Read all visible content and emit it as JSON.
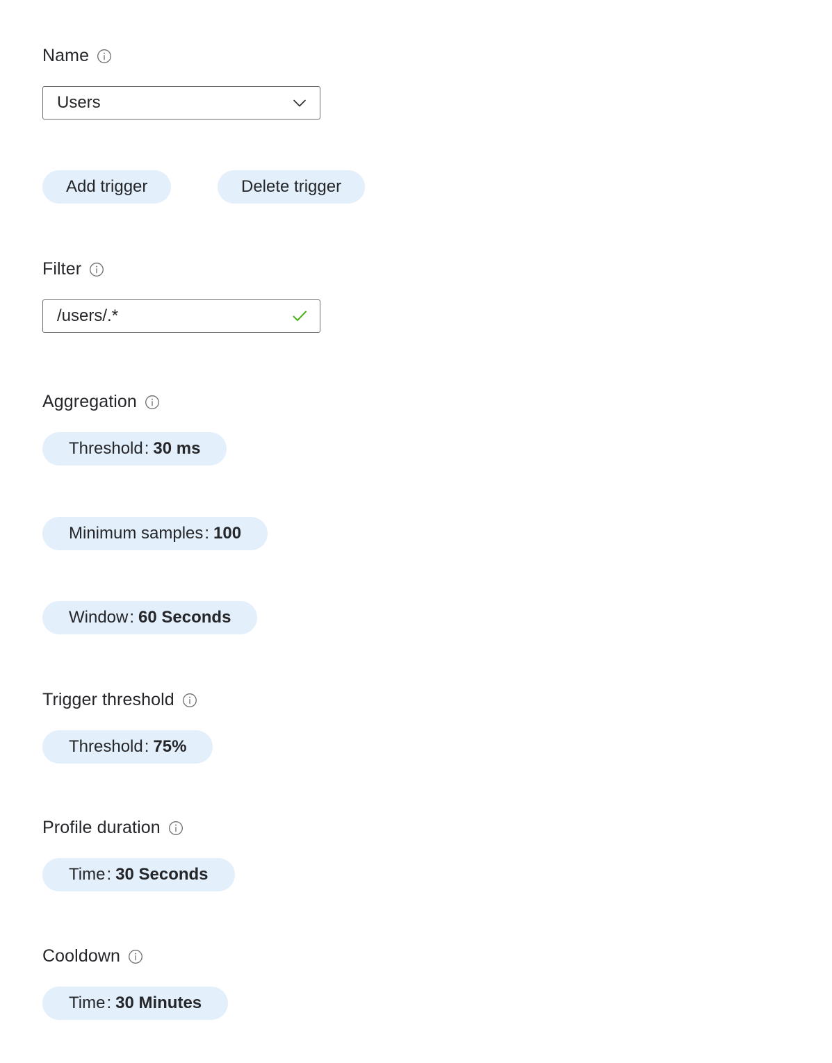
{
  "form": {
    "name": {
      "label": "Name",
      "info_icon": "info-circle-icon",
      "dropdown": {
        "value": "Users",
        "chevron_icon": "chevron-down-icon"
      }
    },
    "actions": {
      "add_trigger_label": "Add trigger",
      "delete_trigger_label": "Delete trigger"
    },
    "filter": {
      "label": "Filter",
      "info_icon": "info-circle-icon",
      "input": {
        "value": "/users/.*",
        "placeholder": "/users/.*",
        "validation_icon": "checkmark-icon",
        "validation_color": "#4caf17"
      }
    },
    "aggregation": {
      "label": "Aggregation",
      "info_icon": "info-circle-icon",
      "pills": [
        {
          "key": "Threshold",
          "sep": ":",
          "value": "30 ms"
        },
        {
          "key": "Minimum samples",
          "sep": ":",
          "value": "100"
        },
        {
          "key": "Window",
          "sep": ":",
          "value": "60 Seconds"
        }
      ]
    },
    "trigger_threshold": {
      "label": "Trigger threshold",
      "info_icon": "info-circle-icon",
      "pills": [
        {
          "key": "Threshold",
          "sep": ":",
          "value": "75%"
        }
      ]
    },
    "profile_duration": {
      "label": "Profile duration",
      "info_icon": "info-circle-icon",
      "pills": [
        {
          "key": "Time",
          "sep": ":",
          "value": "30 Seconds"
        }
      ]
    },
    "cooldown": {
      "label": "Cooldown",
      "info_icon": "info-circle-icon",
      "pills": [
        {
          "key": "Time",
          "sep": ":",
          "value": "30 Minutes"
        }
      ]
    }
  },
  "colors": {
    "pill_background": "#e3effa",
    "text": "#25262a",
    "input_border": "#6b6b6b",
    "success": "#4caf17",
    "page_background": "#ffffff"
  }
}
